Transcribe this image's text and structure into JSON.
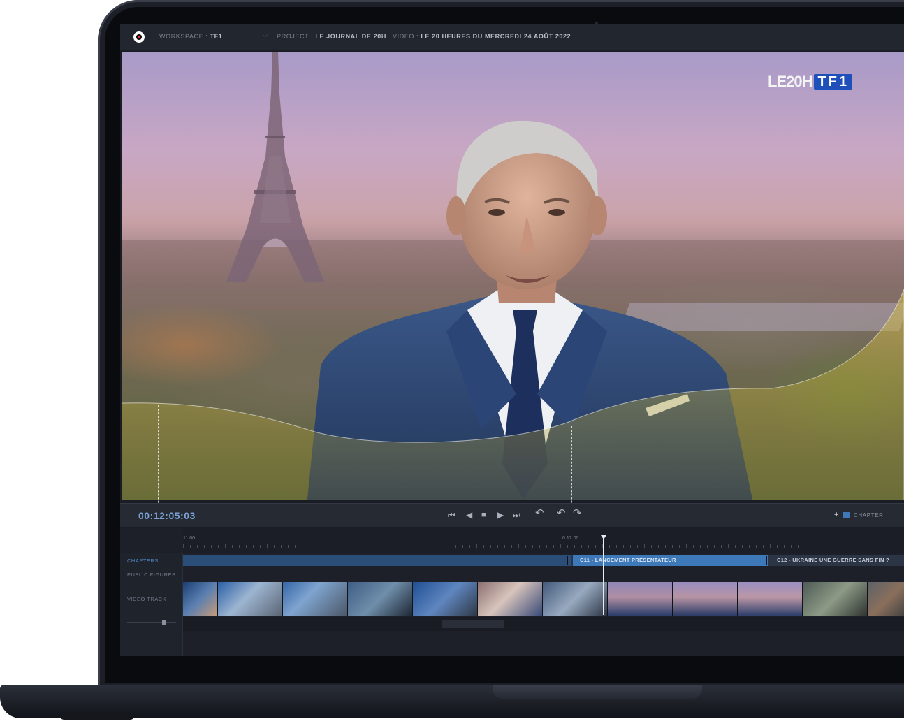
{
  "topbar": {
    "workspace_label": "WORKSPACE :",
    "workspace_value": "TF1",
    "project_label": "PROJECT :",
    "project_value": "LE JOURNAL DE 20H",
    "video_label": "VIDEO :",
    "video_value": "LE 20 HEURES DU MERCREDI 24 AOÛT 2022"
  },
  "video": {
    "channel_logo_text": "LE20H",
    "channel_brand": "TF1"
  },
  "transport": {
    "timecode": "00:12:05:03",
    "controls": [
      "skip-back",
      "step-back",
      "stop",
      "play",
      "skip-forward",
      "undo",
      "rewind-loop",
      "forward-loop"
    ],
    "add_chapter_label": "CHAPTER"
  },
  "timeline": {
    "ruler_labels": [
      "11:00",
      "0:12:00"
    ],
    "tracks": {
      "chapters": "CHAPTERS",
      "public_figures": "PUBLIC FIGURES",
      "video_track": "VIDEO TRACK"
    },
    "chapters": [
      {
        "id": "C10",
        "label": ""
      },
      {
        "id": "C11",
        "label": "C11 - LANCEMENT PRÉSENTATEUR"
      },
      {
        "id": "C12",
        "label": "C12 - UKRAINE UNE GUERRE SANS FIN ?"
      }
    ]
  },
  "colors": {
    "accent": "#3d79b8",
    "timecode": "#7aa2d6",
    "background": "#1a1d24"
  }
}
